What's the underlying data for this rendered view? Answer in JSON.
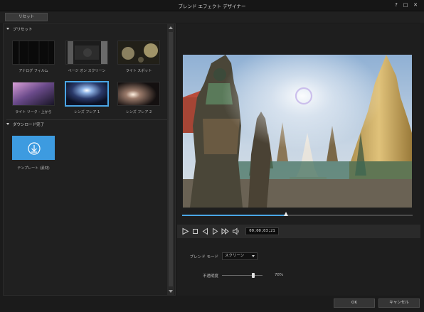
{
  "window": {
    "title": "ブレンド エフェクト デザイナー",
    "help_icon": "?",
    "restore_icon": "□",
    "close_icon": "✕"
  },
  "toolbar": {
    "reset_label": "リセット"
  },
  "presets": {
    "section_label": "プリセット",
    "items": [
      {
        "label": "アナログ フィルム",
        "selected": false
      },
      {
        "label": "ページ オン スクリーン",
        "selected": false
      },
      {
        "label": "ライト スポット",
        "selected": false
      },
      {
        "label": "ライト リーク - 上から",
        "selected": false
      },
      {
        "label": "レンズ フレア 1",
        "selected": true
      },
      {
        "label": "レンズ フレア 2",
        "selected": false
      }
    ]
  },
  "downloads": {
    "section_label": "ダウンロード完了",
    "items": [
      {
        "label": "テンプレート (素材)",
        "icon": "download-icon"
      }
    ]
  },
  "player": {
    "timecode": "00;00;03;21",
    "progress_fraction": 0.45,
    "colors": {
      "accent": "#4aa6e6"
    }
  },
  "settings": {
    "blend_mode_label": "ブレンド モード",
    "blend_mode_value": "スクリーン",
    "opacity_label": "不透明度",
    "opacity_fraction": 0.78,
    "opacity_value": "78%"
  },
  "footer": {
    "ok_label": "OK",
    "cancel_label": "キャンセル"
  }
}
